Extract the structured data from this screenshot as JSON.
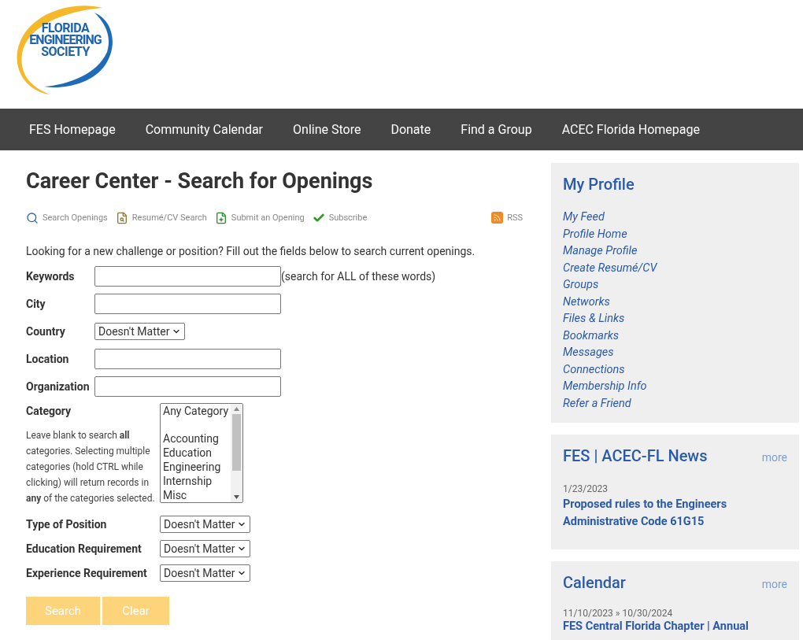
{
  "logo": {
    "lines": [
      "FLORIDA",
      "ENGINEERING",
      "SOCIETY"
    ]
  },
  "nav": [
    "FES Homepage",
    "Community Calendar",
    "Online Store",
    "Donate",
    "Find a Group",
    "ACEC Florida Homepage"
  ],
  "page_title": "Career Center - Search for Openings",
  "toolbar": [
    {
      "kind": "search",
      "label": "Search Openings"
    },
    {
      "kind": "resume",
      "label": "Resumé/CV Search"
    },
    {
      "kind": "submit",
      "label": "Submit an Opening"
    },
    {
      "kind": "subscribe",
      "label": "Subscribe"
    }
  ],
  "rss": "RSS",
  "intro": "Looking for a new challenge or position? Fill out the fields below to search current openings.",
  "fields": [
    {
      "kind": "text",
      "label": "Keywords",
      "note": "(search for ALL of these words)"
    },
    {
      "kind": "text",
      "label": "City"
    },
    {
      "kind": "select",
      "label": "Country",
      "value": "Doesn't Matter"
    },
    {
      "kind": "text",
      "label": "Location"
    },
    {
      "kind": "text",
      "label": "Organization"
    }
  ],
  "category": {
    "label": "Category",
    "help": "Leave blank to search **all** categories. Selecting multiple categories (hold CTRL while clicking) will return records in **any** of the categories selected.",
    "options": [
      "Any Category",
      "Accounting",
      "Education",
      "Engineering",
      "Internship",
      "Misc"
    ]
  },
  "selects": [
    {
      "label": "Type of Position",
      "value": "Doesn't Matter"
    },
    {
      "label": "Education Requirement",
      "value": "Doesn't Matter"
    },
    {
      "label": "Experience Requirement",
      "value": "Doesn't Matter"
    }
  ],
  "buttons": [
    "Search",
    "Clear"
  ],
  "profile": {
    "title": "My Profile",
    "links": [
      "My Feed",
      "Profile Home",
      "Manage Profile",
      "Create Resumé/CV",
      "Groups",
      "Networks",
      "Files & Links",
      "Bookmarks",
      "Messages",
      "Connections",
      "Membership Info",
      "Refer a Friend"
    ]
  },
  "news": {
    "title": "FES | ACEC-FL News",
    "more": "more",
    "items": [
      {
        "date": "1/23/2023",
        "title": "Proposed rules to the Engineers Administrative Code 61G15"
      }
    ]
  },
  "calendar": {
    "title": "Calendar",
    "more": "more",
    "items": [
      {
        "start": "11/10/2023",
        "sep": "»",
        "end": "10/30/2024",
        "title": "FES Central Florida Chapter | Annual"
      }
    ]
  }
}
